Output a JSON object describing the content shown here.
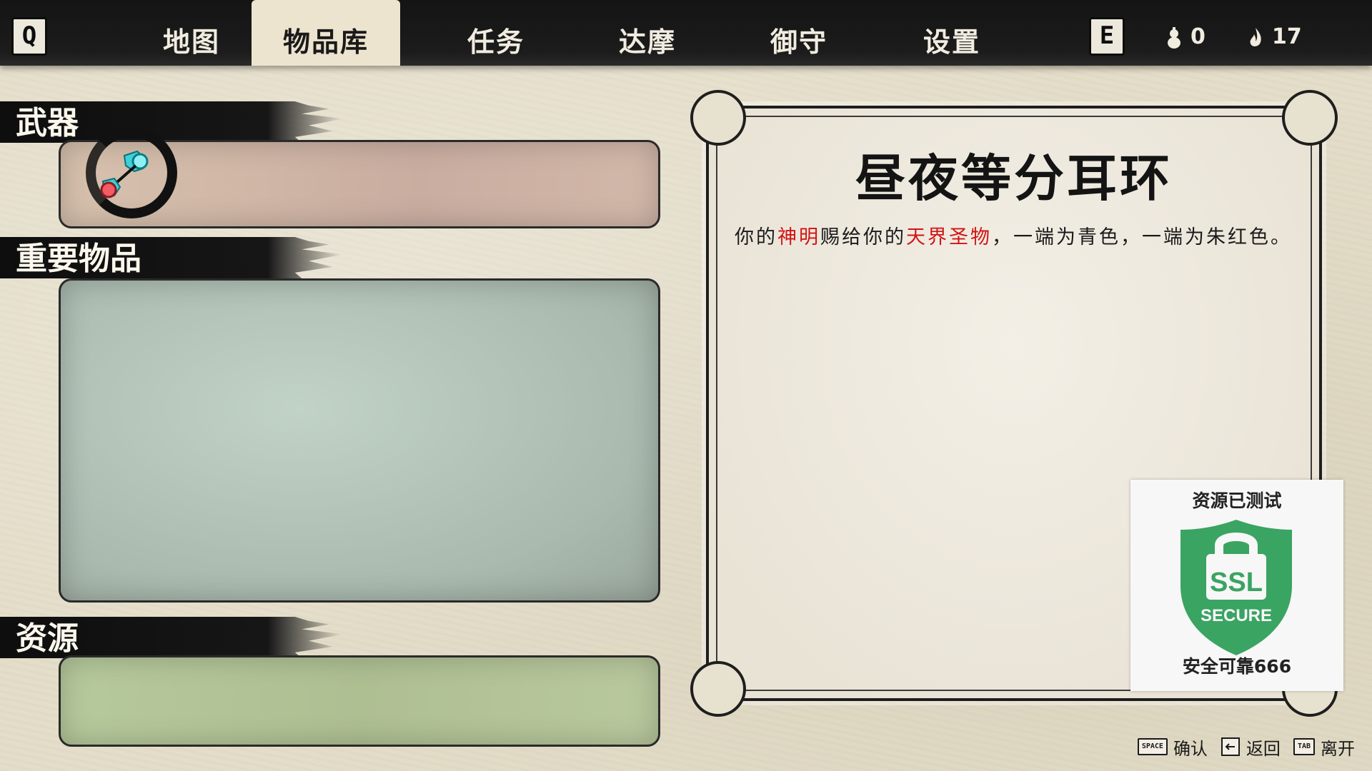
{
  "topbar": {
    "q_key": "Q",
    "e_key": "E",
    "tabs": [
      {
        "label": "地图"
      },
      {
        "label": "物品库"
      },
      {
        "label": "任务"
      },
      {
        "label": "达摩"
      },
      {
        "label": "御守"
      },
      {
        "label": "设置"
      }
    ],
    "active_tab": "物品库",
    "counter_a": {
      "icon": "gourd-icon",
      "value": "0"
    },
    "counter_b": {
      "icon": "flame-icon",
      "value": "17"
    }
  },
  "inventory": {
    "weapons_label": "武器",
    "key_items_label": "重要物品",
    "resources_label": "资源",
    "weapon_slot_icon": "equinox-earring-icon"
  },
  "detail": {
    "title": "昼夜等分耳环",
    "desc_part1": "你的",
    "desc_red1": "神明",
    "desc_part2": "赐给你的",
    "desc_red2": "天界圣物",
    "desc_part3": "，一端为青色，一端为朱红色。"
  },
  "ssl_badge": {
    "top_text": "资源已测试",
    "bottom_text": "安全可靠666",
    "shield_line1": "SSL",
    "shield_line2": "SECURE"
  },
  "hints": {
    "confirm_key": "SPACE",
    "confirm_label": "确认",
    "back_label": "返回",
    "leave_key": "TAB",
    "leave_label": "离开"
  },
  "colors": {
    "topbar": "#141414",
    "paper": "#e4ddc9",
    "highlight_red": "#d11414",
    "weapon_panel": "#c9ada0",
    "key_panel": "#a9b9ae",
    "resource_panel": "#aebf92",
    "ssl_green": "#3aa463"
  }
}
